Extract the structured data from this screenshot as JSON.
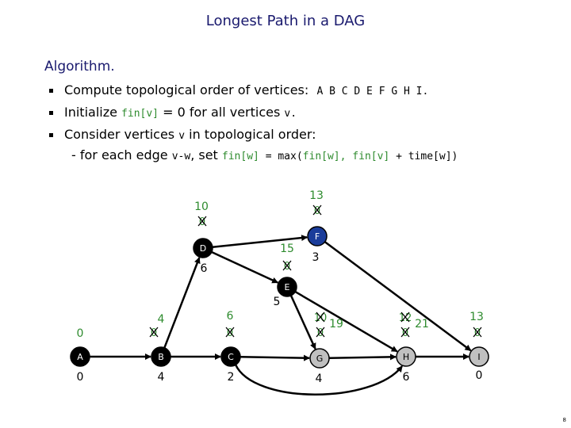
{
  "title": "Longest Path in a DAG",
  "heading": "Algorithm.",
  "bullets": {
    "b1_text": "Compute topological order of vertices:",
    "b1_order": "A B C D E F G H I.",
    "b2_pre": "Initialize ",
    "b2_code": "fin[v]",
    "b2_eq": " = 0",
    "b2_post": " for all vertices ",
    "b2_v": "v.",
    "b3_pre": "Consider vertices ",
    "b3_v": "v",
    "b3_post": " in topological order:",
    "sub_pre": "- for each edge ",
    "sub_vw": "v-w",
    "sub_mid": ", set ",
    "sub_code1": "fin[w]",
    "sub_code2": " = max(",
    "sub_code3": "fin[w], fin[v]",
    "sub_code4": " + time[w])"
  },
  "graph": {
    "nodes": [
      {
        "id": "A",
        "fill": "#000000",
        "text": "#ffffff",
        "time": "0"
      },
      {
        "id": "B",
        "fill": "#000000",
        "text": "#ffffff",
        "time": "4"
      },
      {
        "id": "C",
        "fill": "#000000",
        "text": "#ffffff",
        "time": "2"
      },
      {
        "id": "D",
        "fill": "#000000",
        "text": "#ffffff",
        "time": "6"
      },
      {
        "id": "E",
        "fill": "#000000",
        "text": "#ffffff",
        "time": "5"
      },
      {
        "id": "F",
        "fill": "#1a3c9a",
        "text": "#ffffff",
        "time": "3"
      },
      {
        "id": "G",
        "fill": "#c0c0c0",
        "text": "#000000",
        "time": "4"
      },
      {
        "id": "H",
        "fill": "#c0c0c0",
        "text": "#000000",
        "time": "6"
      },
      {
        "id": "I",
        "fill": "#c0c0c0",
        "text": "#000000",
        "time": "0"
      }
    ],
    "edges": [
      [
        "A",
        "B"
      ],
      [
        "B",
        "C"
      ],
      [
        "B",
        "D"
      ],
      [
        "D",
        "F"
      ],
      [
        "D",
        "E"
      ],
      [
        "C",
        "G"
      ],
      [
        "C",
        "H"
      ],
      [
        "E",
        "G"
      ],
      [
        "E",
        "H"
      ],
      [
        "F",
        "I"
      ],
      [
        "G",
        "H"
      ],
      [
        "H",
        "I"
      ]
    ],
    "fin": {
      "A": {
        "current": "0",
        "crossed": []
      },
      "B": {
        "current": "4",
        "crossed": [
          "0"
        ]
      },
      "C": {
        "current": "6",
        "crossed": [
          "0"
        ]
      },
      "D": {
        "current": "10",
        "crossed": [
          "0"
        ]
      },
      "E": {
        "current": "15",
        "crossed": [
          "0"
        ]
      },
      "F": {
        "current": "13",
        "crossed": [
          "0"
        ]
      },
      "G": {
        "current": "19",
        "crossed": [
          "10",
          "0"
        ]
      },
      "H": {
        "current": "21",
        "crossed": [
          "12",
          "0"
        ]
      },
      "I": {
        "current": "13",
        "crossed": [
          "0"
        ]
      }
    }
  },
  "colors": {
    "fin": "#2e8b2e",
    "title": "#1a1a6e"
  },
  "page_number": "8"
}
